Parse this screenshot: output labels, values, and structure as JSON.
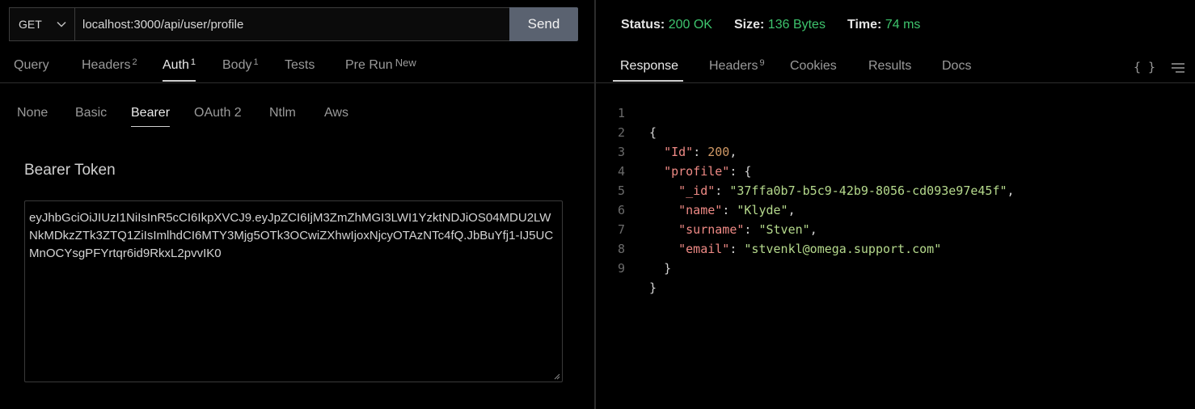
{
  "request": {
    "method": "GET",
    "url": "localhost:3000/api/user/profile",
    "send_label": "Send"
  },
  "request_tabs": [
    {
      "label": "Query",
      "count": ""
    },
    {
      "label": "Headers",
      "count": "2"
    },
    {
      "label": "Auth",
      "count": "1"
    },
    {
      "label": "Body",
      "count": "1"
    },
    {
      "label": "Tests",
      "count": ""
    },
    {
      "label": "Pre Run",
      "count": "New"
    }
  ],
  "auth_tabs": [
    "None",
    "Basic",
    "Bearer",
    "OAuth 2",
    "Ntlm",
    "Aws"
  ],
  "bearer": {
    "label": "Bearer Token",
    "token": "eyJhbGciOiJIUzI1NiIsInR5cCI6IkpXVCJ9.eyJpZCI6IjM3ZmZhMGI3LWI1YzktNDJiOS04MDU2LWNkMDkzZTk3ZTQ1ZiIsImlhdCI6MTY3Mjg5OTk3OCwiZXhwIjoxNjcyOTAzNTc4fQ.JbBuYfj1-IJ5UCMnOCYsgPFYrtqr6id9RkxL2pvvIK0"
  },
  "response_meta": {
    "status_label": "Status:",
    "status_value": "200 OK",
    "size_label": "Size:",
    "size_value": "136 Bytes",
    "time_label": "Time:",
    "time_value": "74 ms",
    "value_color": "#3ec46d"
  },
  "response_tabs": [
    {
      "label": "Response",
      "count": ""
    },
    {
      "label": "Headers",
      "count": "9"
    },
    {
      "label": "Cookies",
      "count": ""
    },
    {
      "label": "Results",
      "count": ""
    },
    {
      "label": "Docs",
      "count": ""
    }
  ],
  "response_toolbar": {
    "format_icon": "{ }",
    "menu_icon": "menu-icon"
  },
  "response_body": {
    "line_numbers": [
      "1",
      "2",
      "3",
      "4",
      "5",
      "6",
      "7",
      "8",
      "9"
    ],
    "brace_open": "{",
    "brace_close": "}",
    "id_key": "\"Id\"",
    "id_value": "200",
    "profile_key": "\"profile\"",
    "fields": [
      {
        "key": "\"_id\"",
        "value": "\"37ffa0b7-b5c9-42b9-8056-cd093e97e45f\"",
        "comma": ","
      },
      {
        "key": "\"name\"",
        "value": "\"Klyde\"",
        "comma": ","
      },
      {
        "key": "\"surname\"",
        "value": "\"Stven\"",
        "comma": ","
      },
      {
        "key": "\"email\"",
        "value": "\"stvenkl@omega.support.com\"",
        "comma": ""
      }
    ]
  }
}
